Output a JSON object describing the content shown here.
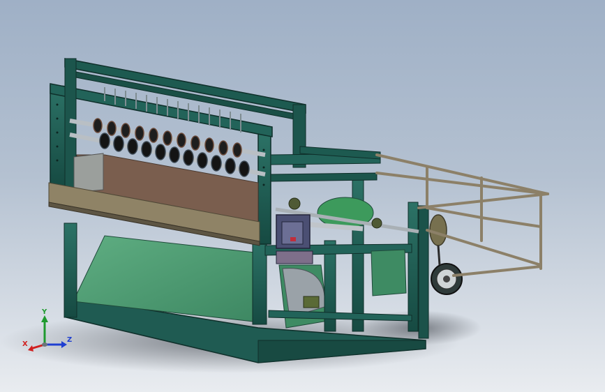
{
  "viewport": {
    "background_top": "#9fb0c6",
    "background_bottom": "#e9ecf0"
  },
  "model": {
    "frame_color": "#1f5b52",
    "frame_edge_color": "#0f2f2a",
    "panel_color": "#4e9a72",
    "guard_rail_color": "#8c8068",
    "roller_color": "#2a2a2a"
  },
  "triad": {
    "x_label": "X",
    "y_label": "Y",
    "z_label": "Z",
    "x_color": "#d11f1f",
    "y_color": "#1f9a2f",
    "z_color": "#1f3fd1"
  }
}
